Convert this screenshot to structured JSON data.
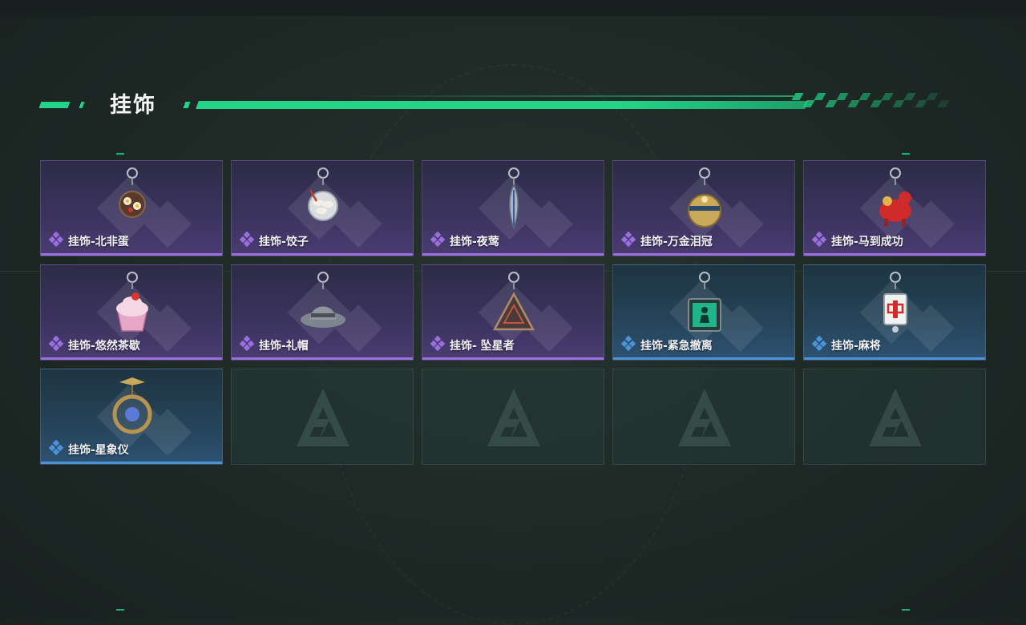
{
  "section": {
    "title": "挂饰"
  },
  "colors": {
    "accent": "#22d487",
    "rarity_purple": "#9a70e0",
    "rarity_blue": "#4d93d9"
  },
  "items": [
    {
      "name": "挂饰-北非蛋",
      "rarity": "purple",
      "icon": "shakshuka-charm-icon"
    },
    {
      "name": "挂饰-饺子",
      "rarity": "purple",
      "icon": "dumpling-plate-charm-icon"
    },
    {
      "name": "挂饰-夜莺",
      "rarity": "purple",
      "icon": "feather-charm-icon"
    },
    {
      "name": "挂饰-万金泪冠",
      "rarity": "purple",
      "icon": "golden-crown-charm-icon"
    },
    {
      "name": "挂饰-马到成功",
      "rarity": "purple",
      "icon": "red-horse-charm-icon"
    },
    {
      "name": "挂饰-悠然茶歇",
      "rarity": "purple",
      "icon": "cupcake-charm-icon"
    },
    {
      "name": "挂饰-礼帽",
      "rarity": "purple",
      "icon": "fedora-hat-charm-icon"
    },
    {
      "name": "挂饰- 坠星者",
      "rarity": "purple",
      "icon": "triangle-emblem-charm-icon"
    },
    {
      "name": "挂饰-紧急撤离",
      "rarity": "blue",
      "icon": "exit-sign-charm-icon"
    },
    {
      "name": "挂饰-麻将",
      "rarity": "blue",
      "icon": "mahjong-tile-charm-icon"
    },
    {
      "name": "挂饰-星象仪",
      "rarity": "blue",
      "icon": "astrolabe-charm-icon"
    }
  ],
  "empty_slots": 4
}
